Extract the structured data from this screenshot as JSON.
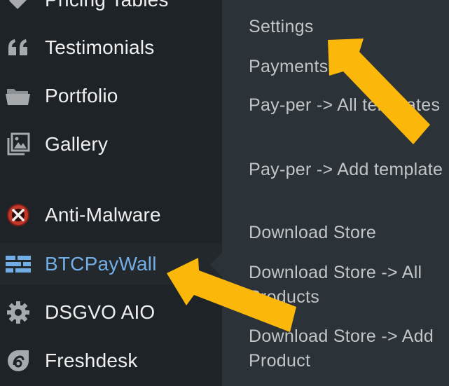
{
  "sidebar": {
    "items": [
      {
        "label": "Pricing Tables",
        "icon": "tag-icon"
      },
      {
        "label": "Testimonials",
        "icon": "quote-icon"
      },
      {
        "label": "Portfolio",
        "icon": "folder-icon"
      },
      {
        "label": "Gallery",
        "icon": "gallery-icon"
      },
      {
        "label": "Anti-Malware",
        "icon": "anti-malware-icon"
      },
      {
        "label": "BTCPayWall",
        "icon": "btcpaywall-icon"
      },
      {
        "label": "DSGVO AIO",
        "icon": "gear-icon"
      },
      {
        "label": "Freshdesk",
        "icon": "freshdesk-icon"
      }
    ],
    "active_label": "BTCPayWall"
  },
  "submenu": {
    "items": [
      {
        "label": "Settings"
      },
      {
        "label": "Payments"
      },
      {
        "label": "Pay-per -> All templates"
      },
      {
        "label": "Pay-per -> Add template"
      },
      {
        "label": "Download Store"
      },
      {
        "label": "Download Store -> All Products"
      },
      {
        "label": "Download Store -> Add Product"
      }
    ]
  },
  "colors": {
    "sidebar_bg": "#1d2327",
    "submenu_bg": "#2c3338",
    "active_text": "#72aee6",
    "arrow": "#fbb80b"
  }
}
